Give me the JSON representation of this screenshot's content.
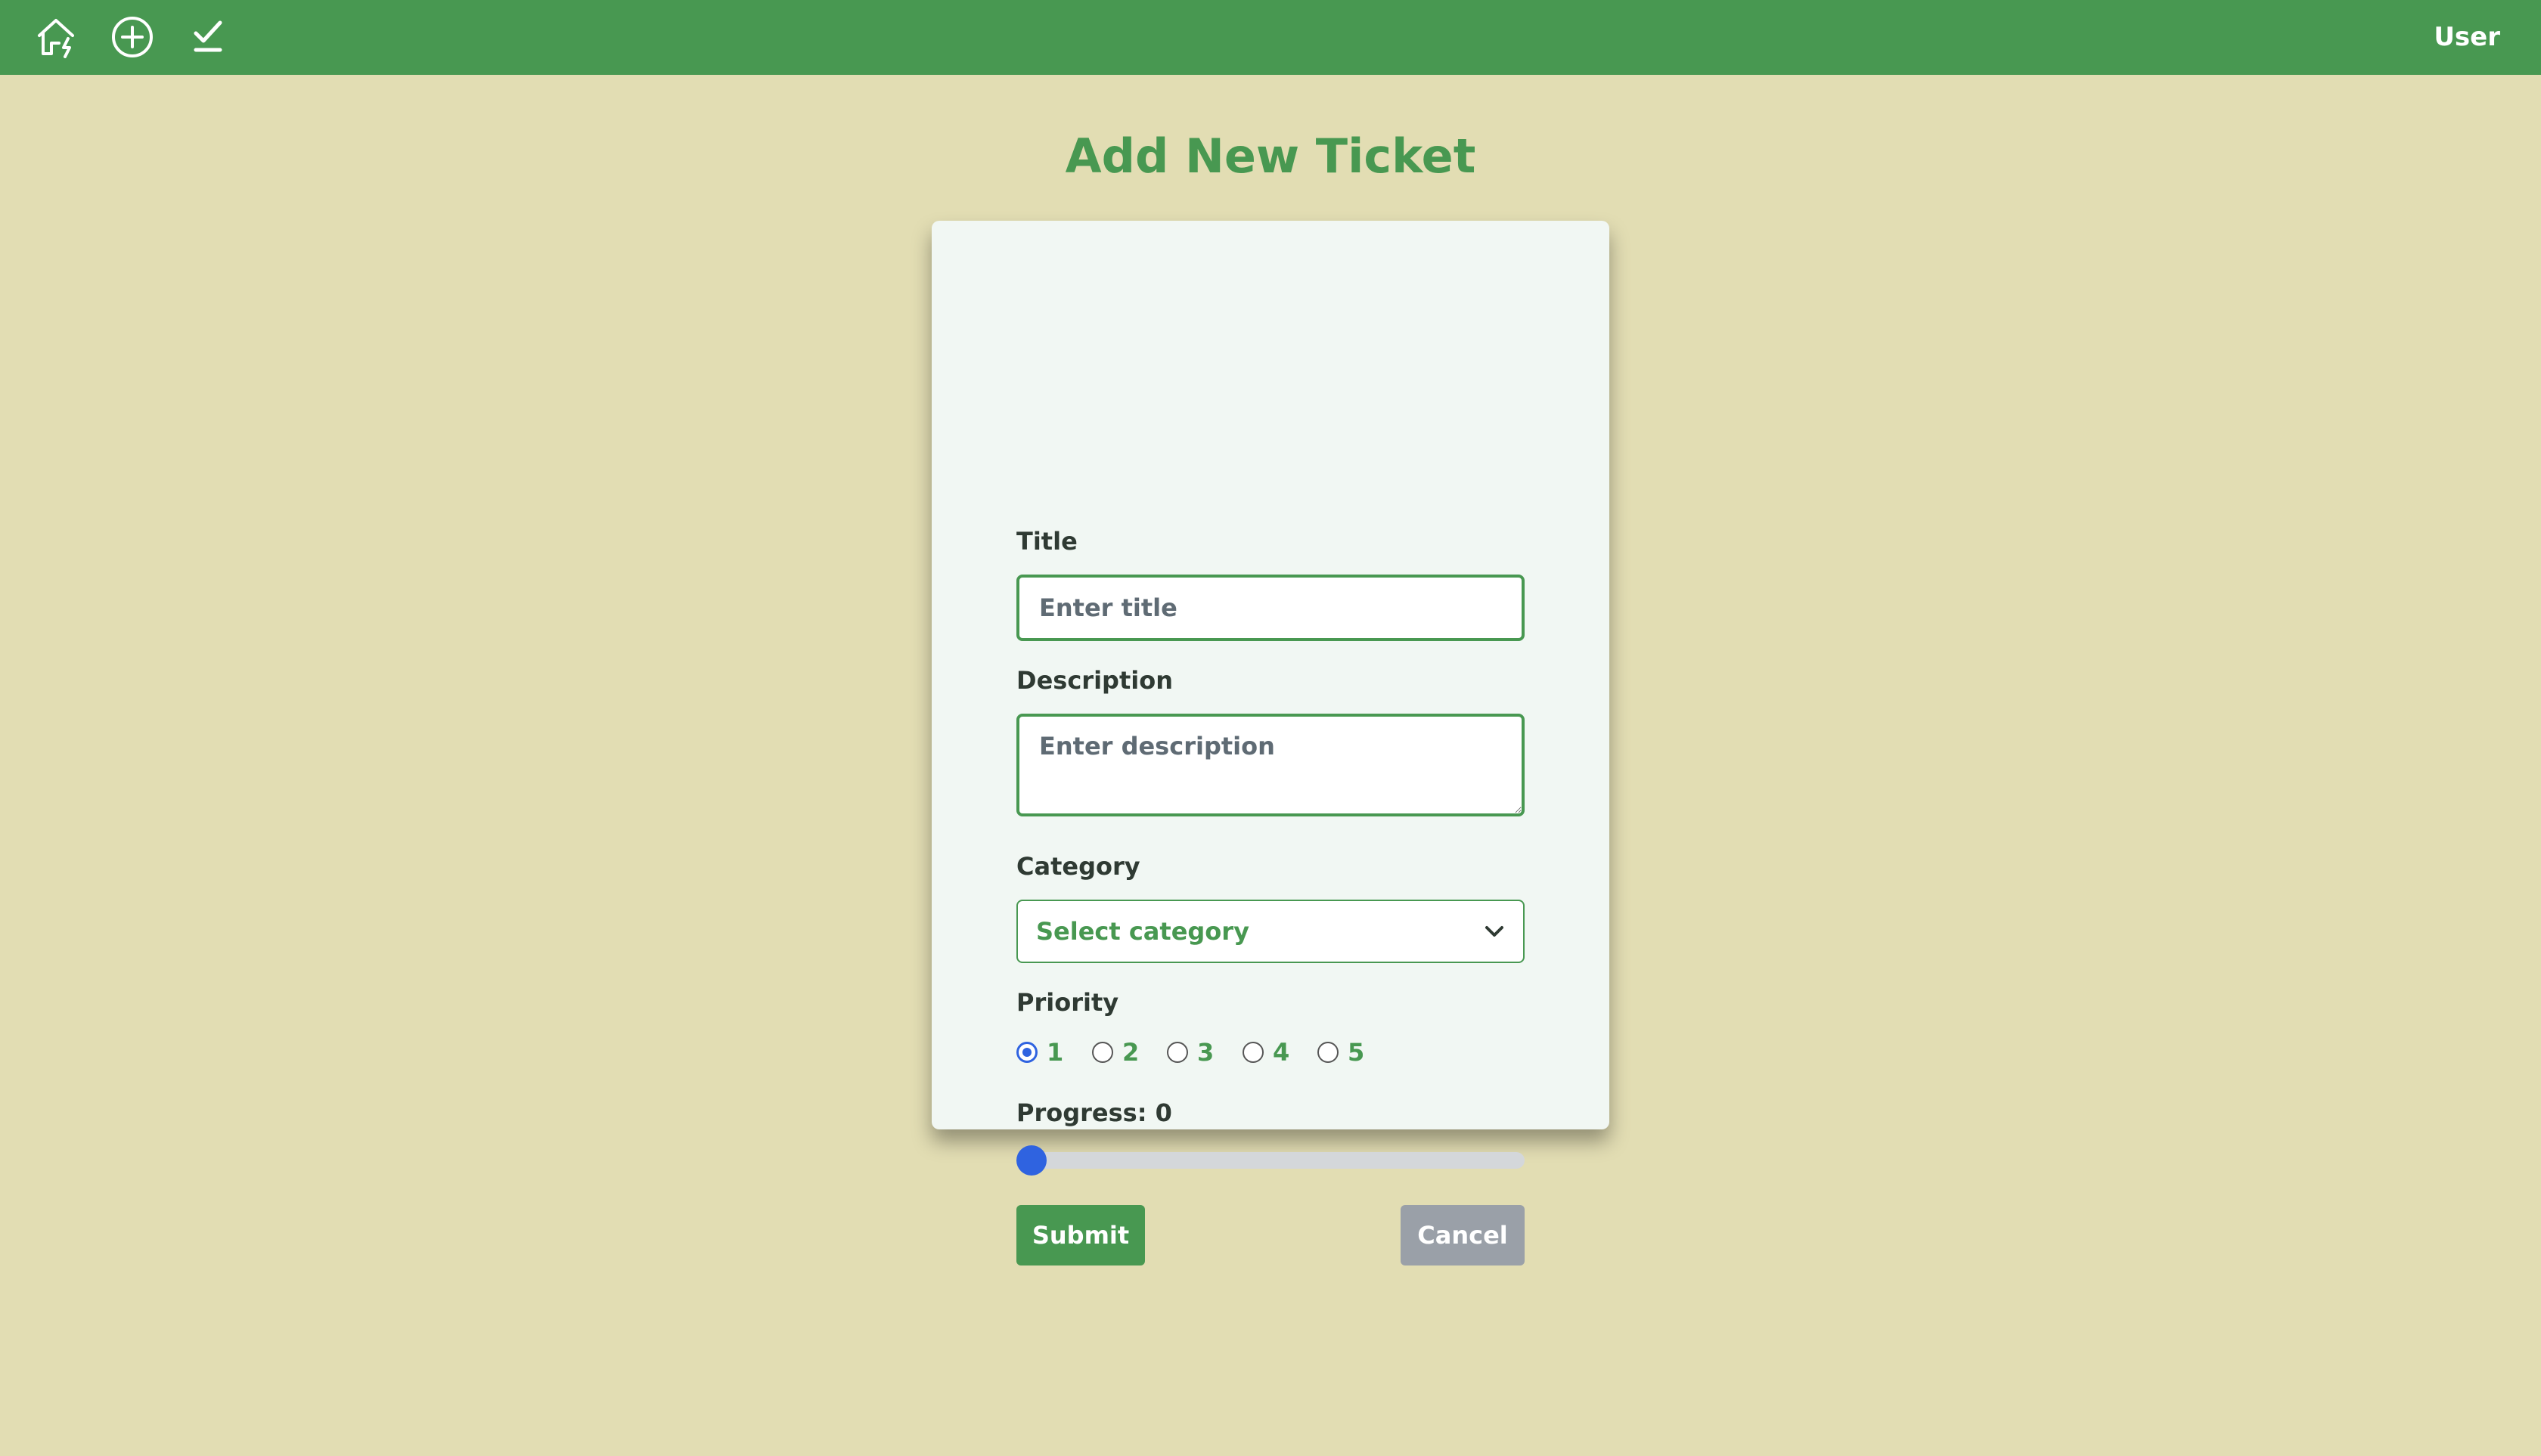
{
  "navbar": {
    "icons": [
      "home-icon",
      "add-circle-icon",
      "checkmark-icon"
    ],
    "user_label": "User"
  },
  "page": {
    "title": "Add New Ticket"
  },
  "form": {
    "title_label": "Title",
    "title_placeholder": "Enter title",
    "title_value": "",
    "description_label": "Description",
    "description_placeholder": "Enter description",
    "description_value": "",
    "category_label": "Category",
    "category_selected": "Select category",
    "priority_label": "Priority",
    "priority_options": [
      "1",
      "2",
      "3",
      "4",
      "5"
    ],
    "priority_selected": "1",
    "progress_label": "Progress: 0",
    "progress_value": 0,
    "submit_label": "Submit",
    "cancel_label": "Cancel"
  },
  "colors": {
    "brand_green": "#489851",
    "background": "#e2ddb3",
    "card": "#f1f7f3",
    "accent_blue": "#2f63e0",
    "cancel_gray": "#9aa0a8"
  }
}
